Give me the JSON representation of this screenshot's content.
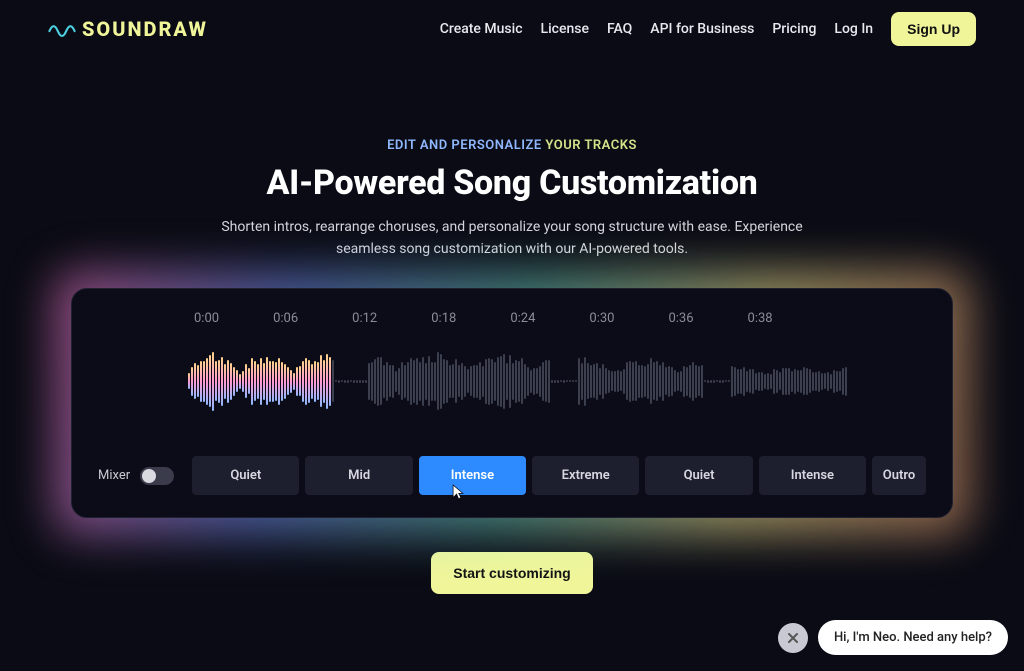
{
  "brand": {
    "name": "SOUNDRAW"
  },
  "nav": {
    "items": [
      "Create Music",
      "License",
      "FAQ",
      "API for Business",
      "Pricing",
      "Log In"
    ],
    "signup": "Sign Up"
  },
  "hero": {
    "eyebrow_a": "EDIT AND PERSONALIZE",
    "eyebrow_b": " YOUR TRACKS",
    "title": "AI-Powered Song Customization",
    "subtitle": "Shorten intros, rearrange choruses, and personalize your song structure with ease. Experience seamless song customization with our AI-powered tools."
  },
  "editor": {
    "timeline": [
      "0:00",
      "0:06",
      "0:12",
      "0:18",
      "0:24",
      "0:30",
      "0:36",
      "0:38"
    ],
    "mixer_label": "Mixer",
    "segments": [
      {
        "label": "Quiet",
        "active": false
      },
      {
        "label": "Mid",
        "active": false
      },
      {
        "label": "Intense",
        "active": true
      },
      {
        "label": "Extreme",
        "active": false
      },
      {
        "label": "Quiet",
        "active": false
      },
      {
        "label": "Intense",
        "active": false
      },
      {
        "label": "Outro",
        "active": false
      }
    ]
  },
  "cta": {
    "label": "Start customizing"
  },
  "chat": {
    "message": "Hi, I'm Neo. Need any help?"
  }
}
